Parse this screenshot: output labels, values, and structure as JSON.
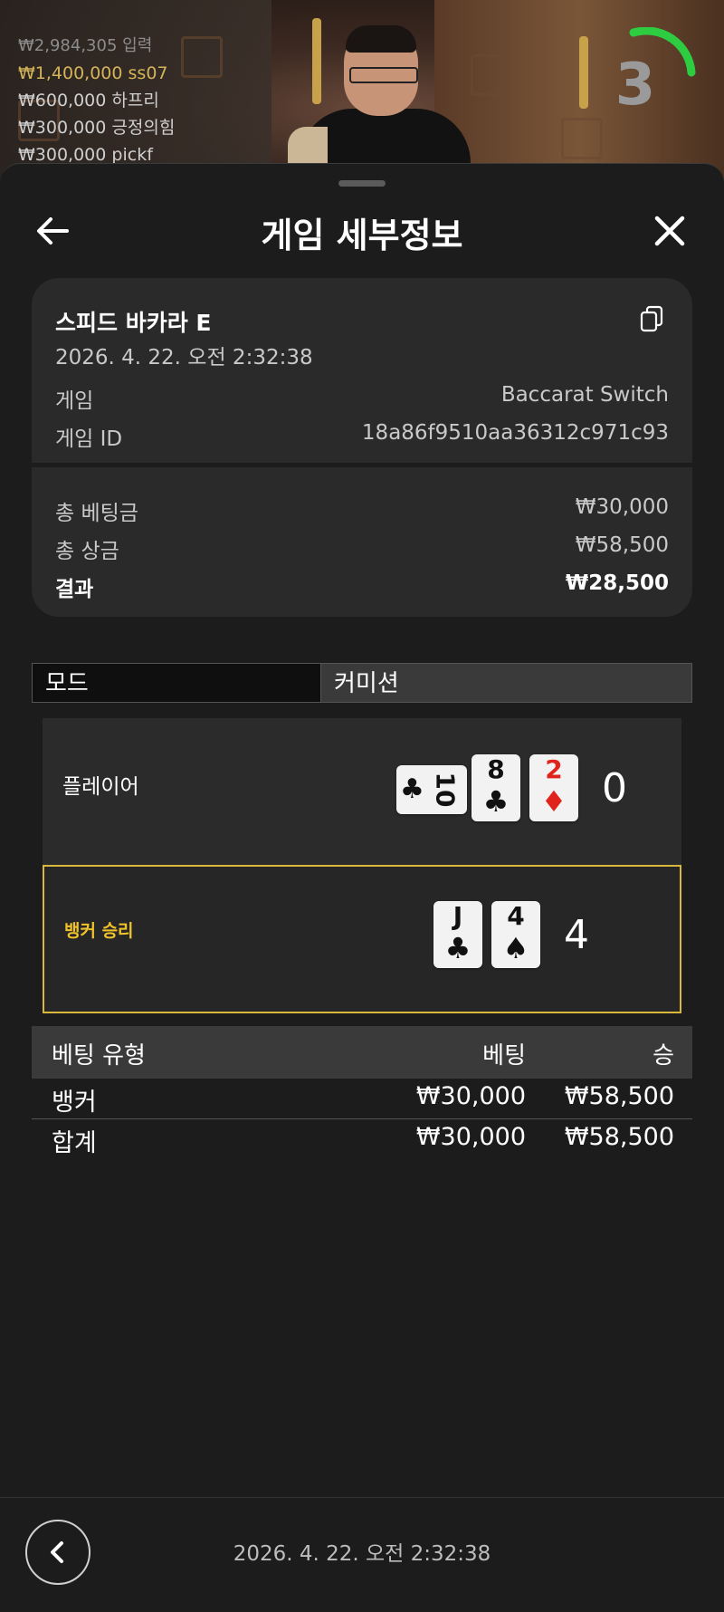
{
  "video": {
    "leaderboard": [
      {
        "amount": "₩2,984,305",
        "name": "입력",
        "style": "top"
      },
      {
        "amount": "₩1,400,000",
        "name": "ss07",
        "style": "gold"
      },
      {
        "amount": "₩600,000",
        "name": "하프리",
        "style": "normal"
      },
      {
        "amount": "₩300,000",
        "name": "긍정의힘",
        "style": "normal"
      },
      {
        "amount": "₩300,000",
        "name": "pickf",
        "style": "normal"
      }
    ],
    "timer": "3"
  },
  "header": {
    "title": "게임 세부정보",
    "back_icon": "arrow-left-icon",
    "close_icon": "close-icon"
  },
  "summary": {
    "game_name": "스피드 바카라 E",
    "datetime": "2026. 4. 22. 오전 2:32:38",
    "game_label": "게임",
    "game_value": "Baccarat Switch",
    "game_id_label": "게임 ID",
    "game_id_value": "18a86f9510aa36312c971c93",
    "total_bet_label": "총 베팅금",
    "total_bet_value": "₩30,000",
    "total_win_label": "총 상금",
    "total_win_value": "₩58,500",
    "result_label": "결과",
    "result_value": "₩28,500"
  },
  "tabs": [
    {
      "label": "모드",
      "active": true
    },
    {
      "label": "커미션",
      "active": false
    }
  ],
  "hands": {
    "player": {
      "label": "플레이어",
      "score": "0",
      "cards": [
        {
          "rank": "10",
          "suit": "♣",
          "color": "black",
          "rotated": true
        },
        {
          "rank": "8",
          "suit": "♣",
          "color": "black",
          "rotated": false
        },
        {
          "rank": "2",
          "suit": "♦",
          "color": "red",
          "rotated": false
        }
      ]
    },
    "banker": {
      "label": "뱅커 승리",
      "score": "4",
      "cards": [
        {
          "rank": "J",
          "suit": "♣",
          "color": "black",
          "rotated": false
        },
        {
          "rank": "4",
          "suit": "♠",
          "color": "black",
          "rotated": false
        }
      ]
    }
  },
  "bets": {
    "headers": [
      "베팅 유형",
      "베팅",
      "승"
    ],
    "rows": [
      {
        "type": "뱅커",
        "bet": "₩30,000",
        "win": "₩58,500"
      },
      {
        "type": "합계",
        "bet": "₩30,000",
        "win": "₩58,500"
      }
    ]
  },
  "footer": {
    "datetime": "2026. 4. 22. 오전 2:32:38",
    "prev_icon": "chevron-left-icon"
  },
  "colors": {
    "highlight": "#d8b73a",
    "banker_text": "#f0c22b",
    "card_red": "#e0231c",
    "timer_green": "#2ecc40"
  }
}
